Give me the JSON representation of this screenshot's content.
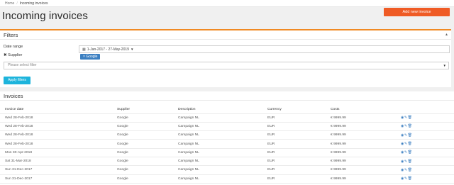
{
  "breadcrumb": {
    "home": "Home",
    "current": "Incoming invoices"
  },
  "page": {
    "title": "Incoming invoices",
    "add_label": "Add new invoice"
  },
  "filters": {
    "title": "Filters",
    "collapse_icon": "▴",
    "date_label": "Date range",
    "date_value": "1-Jan-2017 - 27-May-2019",
    "supplier_label": "Supplier",
    "supplier_tag": "× Google",
    "select_placeholder": "Please select filter",
    "apply_label": "Apply filters"
  },
  "invoices": {
    "title": "Invoices",
    "columns": [
      "Invoice date",
      "Supplier",
      "Description",
      "Currency",
      "Costs"
    ],
    "rows": [
      [
        "Wed 28-Feb-2018",
        "Google",
        "Campaign NL",
        "EUR",
        "€ 9999.99"
      ],
      [
        "Wed 28-Feb-2018",
        "Google",
        "Campaign NL",
        "EUR",
        "€ 9999.99"
      ],
      [
        "Wed 28-Feb-2018",
        "Google",
        "Campaign NL",
        "EUR",
        "€ 9999.99"
      ],
      [
        "Wed 28-Feb-2018",
        "Google",
        "Campaign NL",
        "EUR",
        "€ 9999.99"
      ],
      [
        "Mon 30-Apr-2018",
        "Google",
        "Campaign NL",
        "EUR",
        "€ 9999.99"
      ],
      [
        "Sat 31-Mar-2018",
        "Google",
        "Campaign NL",
        "EUR",
        "€ 9999.99"
      ],
      [
        "Sun 31-Dec-2017",
        "Google",
        "Campaign NL",
        "EUR",
        "€ 9999.99"
      ],
      [
        "Sun 31-Dec-2017",
        "Google",
        "Campaign NL",
        "EUR",
        "€ 9999.99"
      ]
    ]
  },
  "colors": {
    "accent": "#ef5b25",
    "apply": "#1db4dc",
    "tag": "#3c7fc1"
  },
  "icons": {
    "view": "eye-icon",
    "edit": "pencil-icon",
    "delete": "trash-icon",
    "calendar": "calendar-icon"
  }
}
